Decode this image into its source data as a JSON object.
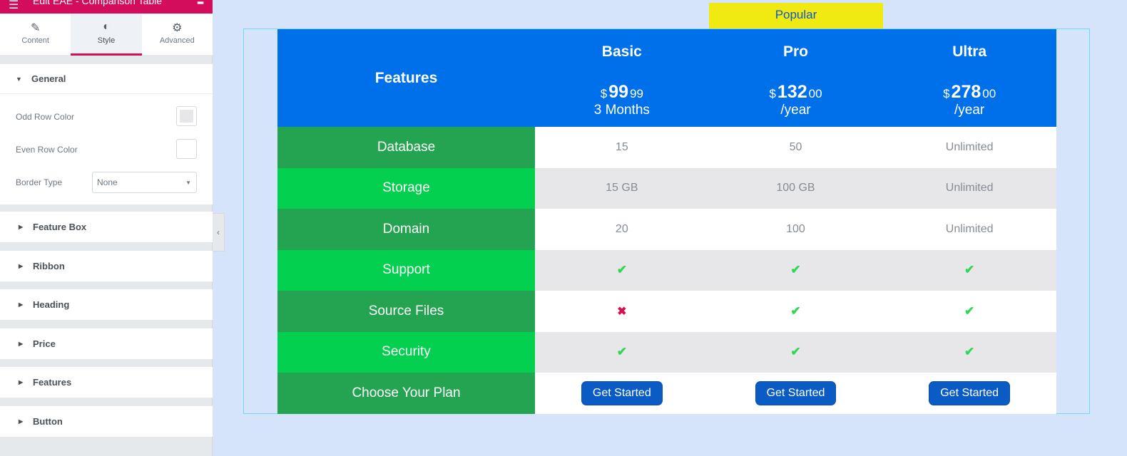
{
  "topbar": {
    "title": "Edit EAE - Comparison Table"
  },
  "tabs": [
    {
      "label": "Content",
      "icon": "pencil-icon"
    },
    {
      "label": "Style",
      "icon": "contrast-icon"
    },
    {
      "label": "Advanced",
      "icon": "gear-icon"
    }
  ],
  "general": {
    "title": "General",
    "odd_row_label": "Odd Row Color",
    "even_row_label": "Even Row Color",
    "border_type_label": "Border Type",
    "border_type_value": "None",
    "odd_color": "#e7e7ea",
    "even_color": "#ffffff"
  },
  "sections": [
    "Feature Box",
    "Ribbon",
    "Heading",
    "Price",
    "Features",
    "Button"
  ],
  "ribbon": {
    "label": "Popular"
  },
  "table": {
    "feature_header": "Features",
    "plans": [
      {
        "name": "Basic",
        "currency": "$",
        "amount": "99",
        "cents": "99",
        "period": "3 Months"
      },
      {
        "name": "Pro",
        "currency": "$",
        "amount": "132",
        "cents": "00",
        "period": "/year"
      },
      {
        "name": "Ultra",
        "currency": "$",
        "amount": "278",
        "cents": "00",
        "period": "/year"
      }
    ],
    "rows": [
      {
        "label": "Database",
        "values": [
          "15",
          "50",
          "Unlimited"
        ]
      },
      {
        "label": "Storage",
        "values": [
          "15 GB",
          "100 GB",
          "Unlimited"
        ]
      },
      {
        "label": "Domain",
        "values": [
          "20",
          "100",
          "Unlimited"
        ]
      },
      {
        "label": "Support",
        "values": [
          "check",
          "check",
          "check"
        ]
      },
      {
        "label": "Source Files",
        "values": [
          "cross",
          "check",
          "check"
        ]
      },
      {
        "label": "Security",
        "values": [
          "check",
          "check",
          "check"
        ]
      }
    ],
    "footer": {
      "label": "Choose Your Plan",
      "buttons": [
        "Get Started",
        "Get Started",
        "Get Started"
      ]
    }
  }
}
